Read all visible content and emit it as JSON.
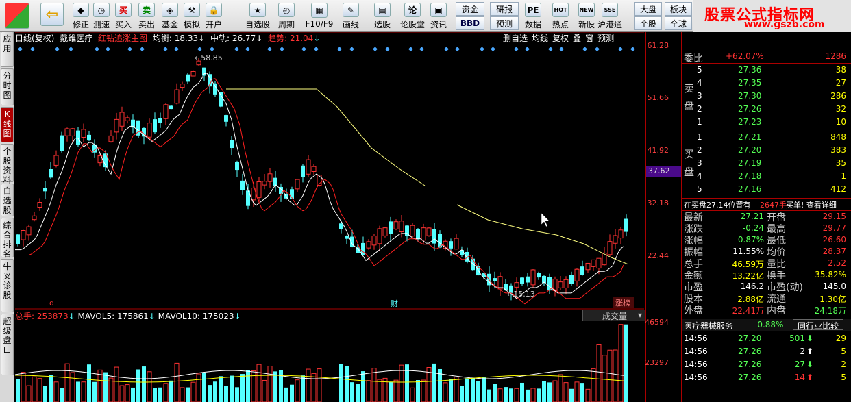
{
  "toolbar": {
    "buttons": [
      {
        "label": "修正",
        "icon": "◆"
      },
      {
        "label": "测速",
        "icon": "◷"
      },
      {
        "label": "买入",
        "icon": "买"
      },
      {
        "label": "卖出",
        "icon": "卖"
      },
      {
        "label": "基金",
        "icon": "◈"
      },
      {
        "label": "模拟",
        "icon": "⚒"
      },
      {
        "label": "开户",
        "icon": "🔒"
      },
      {
        "label": "自选股",
        "icon": "★"
      },
      {
        "label": "周期",
        "icon": "◴"
      },
      {
        "label": "F10/F9",
        "icon": "▦"
      },
      {
        "label": "画线",
        "icon": "✎"
      },
      {
        "label": "选股",
        "icon": "▤"
      },
      {
        "label": "论股堂",
        "icon": "论"
      },
      {
        "label": "资讯",
        "icon": "▣"
      },
      {
        "label": "数据",
        "icon": "PE"
      },
      {
        "label": "热点",
        "icon": "HOT"
      },
      {
        "label": "新股",
        "icon": "NEW"
      },
      {
        "label": "沪港通",
        "icon": "SSE"
      }
    ],
    "small": {
      "zijin": "资金",
      "bbd": "BBD",
      "yanbao": "研报",
      "yuce": "预测",
      "dapan": "大盘",
      "bankuai": "板块",
      "gegu": "个股",
      "quanqiu": "全球"
    },
    "brand_text": "股票公式指标网",
    "brand_url": "www.gszb.com"
  },
  "left_tabs": [
    "应用",
    "分时图",
    "K线图",
    "个股资料",
    "自选股",
    "综合排名",
    "牛叉诊股",
    "超级盘口"
  ],
  "chart_header": {
    "period": "日线(复权)",
    "stock": "戴维医疗",
    "indicator": "红钻追涨主图",
    "junheng": "均衡: 18.33",
    "zhonggui": "中轨: 26.77",
    "qushi": "趋势: 21.04",
    "right_buttons": [
      "删自选",
      "均线",
      "复权",
      "叠",
      "窗",
      "预测"
    ]
  },
  "price_axis": {
    "ticks": [
      "61.28",
      "51.66",
      "41.92",
      "32.18",
      "22.44"
    ],
    "current": "37.62"
  },
  "volume_axis": {
    "ticks": [
      "46594",
      "23297"
    ]
  },
  "annotations": {
    "high": "58.85",
    "low": "15.13",
    "q": "q",
    "cai": "财",
    "zhangbang": "涨榜"
  },
  "volume_header": {
    "zongshou": "总手: 253873",
    "mavol5": "MAVOL5: 175861",
    "mavol10": "MAVOL10: 175023",
    "selector": "成交量"
  },
  "quote": {
    "weibi_label": "委比",
    "weibi_val": "+62.07%",
    "weicha": "1286",
    "sell_label": "卖盘",
    "sell": [
      {
        "lvl": "5",
        "price": "27.36",
        "vol": "38"
      },
      {
        "lvl": "4",
        "price": "27.35",
        "vol": "27"
      },
      {
        "lvl": "3",
        "price": "27.30",
        "vol": "286"
      },
      {
        "lvl": "2",
        "price": "27.26",
        "vol": "32"
      },
      {
        "lvl": "1",
        "price": "27.23",
        "vol": "10"
      }
    ],
    "buy_label": "买盘",
    "buy": [
      {
        "lvl": "1",
        "price": "27.21",
        "vol": "848"
      },
      {
        "lvl": "2",
        "price": "27.20",
        "vol": "383"
      },
      {
        "lvl": "3",
        "price": "27.19",
        "vol": "35"
      },
      {
        "lvl": "4",
        "price": "27.18",
        "vol": "1"
      },
      {
        "lvl": "5",
        "price": "27.16",
        "vol": "412"
      }
    ],
    "info_line": "在买盘27.14位置有",
    "info_vol": "2647手",
    "info_tail": "买单! 查看详细",
    "stats": [
      {
        "l1": "最新",
        "v1": "27.21",
        "l2": "开盘",
        "v2": "29.15"
      },
      {
        "l1": "涨跌",
        "v1": "-0.24",
        "l2": "最高",
        "v2": "29.77"
      },
      {
        "l1": "涨幅",
        "v1": "-0.87%",
        "l2": "最低",
        "v2": "26.60"
      },
      {
        "l1": "振幅",
        "v1": "11.55%",
        "l2": "均价",
        "v2": "28.37"
      },
      {
        "l1": "总手",
        "v1": "46.59万",
        "l2": "量比",
        "v2": "2.52"
      },
      {
        "l1": "金额",
        "v1": "13.22亿",
        "l2": "换手",
        "v2": "35.82%"
      },
      {
        "l1": "市盈",
        "v1": "146.2",
        "l2": "市盈(动)",
        "v2": "145.0"
      },
      {
        "l1": "股本",
        "v1": "2.88亿",
        "l2": "流通",
        "v2": "1.30亿"
      },
      {
        "l1": "外盘",
        "v1": "22.41万",
        "l2": "内盘",
        "v2": "24.18万"
      }
    ],
    "industry": "医疗器械服务",
    "industry_pct": "-0.88%",
    "industry_btn": "同行业比较",
    "ticks": [
      {
        "t": "14:56",
        "p": "27.20",
        "v": "501",
        "dir": "down",
        "n": "29"
      },
      {
        "t": "14:56",
        "p": "27.26",
        "v": "2",
        "dir": "up",
        "n": "5"
      },
      {
        "t": "14:56",
        "p": "27.26",
        "v": "27",
        "dir": "down",
        "n": "2"
      },
      {
        "t": "14:56",
        "p": "27.26",
        "v": "14",
        "dir": "up",
        "n": "5"
      }
    ]
  },
  "colors": {
    "up": "#ff3232",
    "down": "#54ffff",
    "yellow": "#ffff00",
    "axis": "#b00000"
  }
}
